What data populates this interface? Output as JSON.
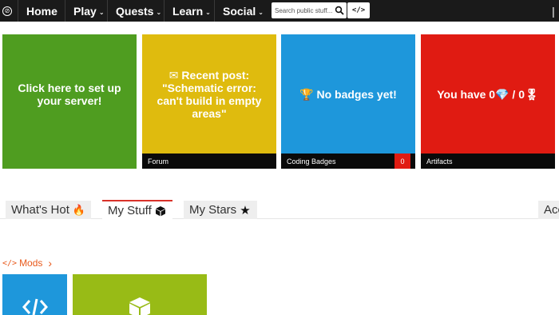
{
  "navbar": {
    "items": [
      {
        "label": "Home",
        "has_caret": false
      },
      {
        "label": "Play",
        "has_caret": true
      },
      {
        "label": "Quests",
        "has_caret": true
      },
      {
        "label": "Learn",
        "has_caret": true
      },
      {
        "label": "Social",
        "has_caret": true
      }
    ],
    "caret_glyph": "⌄",
    "search": {
      "placeholder": "Search public stuff...",
      "icon": "search-icon"
    },
    "code_button_label": "</>",
    "right_glyph": "|"
  },
  "tiles": [
    {
      "id": "server",
      "text": "Click here to set up your server!",
      "footer": "",
      "color": "#4f9d20"
    },
    {
      "id": "forum",
      "text": "✉ Recent post: \"Schematic error: can't build in empty areas\"",
      "footer": "Forum",
      "color": "#dfbb0e"
    },
    {
      "id": "badges",
      "text": "🏆 No badges yet!",
      "footer": "Coding Badges",
      "count": "0",
      "color": "#1e97db"
    },
    {
      "id": "artifacts",
      "text": "You have 0💎 / 0🎖",
      "footer": "Artifacts",
      "color": "#e01b12"
    }
  ],
  "tabs": [
    {
      "label": "What's Hot",
      "icon": "fire-icon",
      "glyph": "🔥",
      "active": false
    },
    {
      "label": "My Stuff",
      "icon": "cube-icon",
      "glyph": "",
      "active": true
    },
    {
      "label": "My Stars",
      "icon": "star-icon",
      "glyph": "★",
      "active": false
    },
    {
      "label": "Acc",
      "icon": "",
      "glyph": "",
      "active": false
    }
  ],
  "mods": {
    "label": "Mods",
    "prefix": "</>",
    "chevron": "›",
    "accent": "#e85a1c"
  },
  "colors": {
    "navbar": "#1a1a1a",
    "tab_active_border": "#d9322a"
  }
}
